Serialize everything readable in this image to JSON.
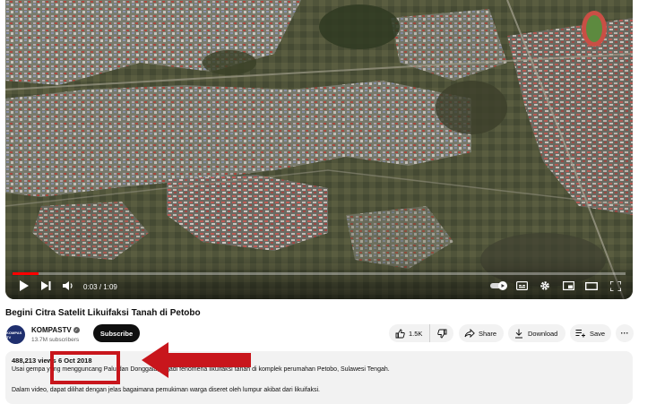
{
  "player": {
    "current_time": "0:03",
    "duration": "1:09",
    "progress_fraction": 0.043,
    "icons": [
      "play-icon",
      "next-icon",
      "volume-icon",
      "autoplay-toggle-icon",
      "captions-icon",
      "settings-icon",
      "miniplayer-icon",
      "theater-icon",
      "fullscreen-icon"
    ]
  },
  "video": {
    "title": "Begini Citra Satelit Likuifaksi Tanah di Petobo"
  },
  "channel": {
    "name": "KOMPASTV",
    "avatar_text": "KOMPAS TV",
    "subscribers": "13.7M subscribers",
    "subscribe_label": "Subscribe"
  },
  "actions": {
    "likes": "1.5K",
    "share_label": "Share",
    "download_label": "Download",
    "save_label": "Save",
    "more_label": "···"
  },
  "description": {
    "views": "488,213 views",
    "date": "6 Oct 2018",
    "line1": "Usai gempa yang mengguncang Palu dan Donggala, terjadi fenomena likuifaksi tanah di komplek perumahan Petobo, Sulawesi Tengah.",
    "line2": "Dalam video, dapat dilihat dengan jelas bagaimana pemukiman warga diseret oleh lumpur akibat dari likuifaksi."
  },
  "colors": {
    "annotation_red": "#c8161c",
    "progress_red": "#ff0000",
    "pill_bg": "#f2f2f2"
  }
}
